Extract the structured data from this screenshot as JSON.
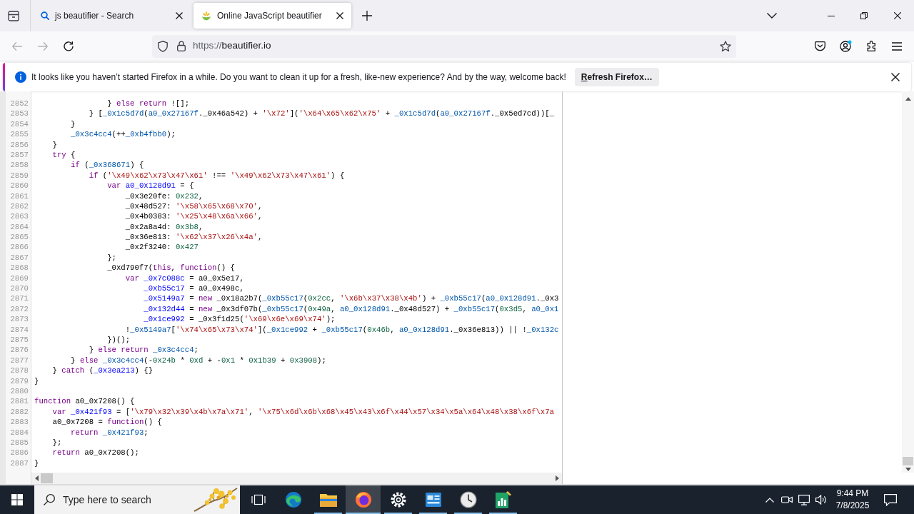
{
  "browser": {
    "tabs": [
      {
        "title": "js beautifier - Search",
        "selected": false
      },
      {
        "title": "Online JavaScript beautifier",
        "selected": true
      }
    ],
    "navigation": {
      "back": {
        "disabled": true
      },
      "forward": {
        "disabled": true
      }
    },
    "address": {
      "scheme": "https://",
      "host": "beautifier.io"
    }
  },
  "notification": {
    "message": "It looks like you haven’t started Firefox in a while. Do you want to clean it up for a fresh, like-new experience? And by the way, welcome back!",
    "button": "Refresh Firefox…"
  },
  "editor": {
    "lines": [
      {
        "number": "2852",
        "tokens": [
          {
            "kind": "plain",
            "text": "                } "
          },
          {
            "kind": "keyword",
            "text": "else"
          },
          {
            "kind": "keyword",
            "text": " return"
          },
          {
            "kind": "plain",
            "text": " ![];"
          }
        ]
      },
      {
        "number": "2853",
        "tokens": [
          {
            "kind": "plain",
            "text": "            } ["
          },
          {
            "kind": "variable",
            "text": "_0x1c5d7d"
          },
          {
            "kind": "plain",
            "text": "("
          },
          {
            "kind": "variable",
            "text": "a0_0x27167f"
          },
          {
            "kind": "plain",
            "text": "._0x46a542) + "
          },
          {
            "kind": "string",
            "text": "'\\x72'"
          },
          {
            "kind": "plain",
            "text": "]("
          },
          {
            "kind": "string",
            "text": "'\\x64\\x65\\x62\\x75'"
          },
          {
            "kind": "plain",
            "text": " + "
          },
          {
            "kind": "variable",
            "text": "_0x1c5d7d"
          },
          {
            "kind": "plain",
            "text": "("
          },
          {
            "kind": "variable",
            "text": "a0_0x27167f"
          },
          {
            "kind": "plain",
            "text": "._0x5ed7cd))[_"
          }
        ]
      },
      {
        "number": "2854",
        "tokens": [
          {
            "kind": "plain",
            "text": "        }"
          }
        ]
      },
      {
        "number": "2855",
        "tokens": [
          {
            "kind": "variable",
            "text": "        _0x3c4cc4"
          },
          {
            "kind": "plain",
            "text": "(++"
          },
          {
            "kind": "variable",
            "text": "_0xb4fbb0"
          },
          {
            "kind": "plain",
            "text": ");"
          }
        ]
      },
      {
        "number": "2856",
        "tokens": [
          {
            "kind": "plain",
            "text": "    }"
          }
        ]
      },
      {
        "number": "2857",
        "tokens": [
          {
            "kind": "keyword",
            "text": "    try"
          },
          {
            "kind": "plain",
            "text": " {"
          }
        ]
      },
      {
        "number": "2858",
        "tokens": [
          {
            "kind": "keyword",
            "text": "        if"
          },
          {
            "kind": "plain",
            "text": " ("
          },
          {
            "kind": "variable",
            "text": "_0x368671"
          },
          {
            "kind": "plain",
            "text": ") {"
          }
        ]
      },
      {
        "number": "2859",
        "tokens": [
          {
            "kind": "keyword",
            "text": "            if"
          },
          {
            "kind": "plain",
            "text": " ("
          },
          {
            "kind": "string",
            "text": "'\\x49\\x62\\x73\\x47\\x61'"
          },
          {
            "kind": "plain",
            "text": " !== "
          },
          {
            "kind": "string",
            "text": "'\\x49\\x62\\x73\\x47\\x61'"
          },
          {
            "kind": "plain",
            "text": ") {"
          }
        ]
      },
      {
        "number": "2860",
        "tokens": [
          {
            "kind": "keyword",
            "text": "                var "
          },
          {
            "kind": "def",
            "text": "a0_0x128d91"
          },
          {
            "kind": "plain",
            "text": " = {"
          }
        ]
      },
      {
        "number": "2861",
        "tokens": [
          {
            "kind": "plain",
            "text": "                    _0x3e20fe: "
          },
          {
            "kind": "number",
            "text": "0x232"
          },
          {
            "kind": "plain",
            "text": ","
          }
        ]
      },
      {
        "number": "2862",
        "tokens": [
          {
            "kind": "plain",
            "text": "                    _0x48d527: "
          },
          {
            "kind": "string",
            "text": "'\\x58\\x65\\x68\\x70'"
          },
          {
            "kind": "plain",
            "text": ","
          }
        ]
      },
      {
        "number": "2863",
        "tokens": [
          {
            "kind": "plain",
            "text": "                    _0x4b0383: "
          },
          {
            "kind": "string",
            "text": "'\\x25\\x48\\x6a\\x66'"
          },
          {
            "kind": "plain",
            "text": ","
          }
        ]
      },
      {
        "number": "2864",
        "tokens": [
          {
            "kind": "plain",
            "text": "                    _0x2a8a4d: "
          },
          {
            "kind": "number",
            "text": "0x3b8"
          },
          {
            "kind": "plain",
            "text": ","
          }
        ]
      },
      {
        "number": "2865",
        "tokens": [
          {
            "kind": "plain",
            "text": "                    _0x36e813: "
          },
          {
            "kind": "string",
            "text": "'\\x62\\x37\\x26\\x4a'"
          },
          {
            "kind": "plain",
            "text": ","
          }
        ]
      },
      {
        "number": "2866",
        "tokens": [
          {
            "kind": "plain",
            "text": "                    _0x2f3240: "
          },
          {
            "kind": "number",
            "text": "0x427"
          }
        ]
      },
      {
        "number": "2867",
        "tokens": [
          {
            "kind": "plain",
            "text": "                };"
          }
        ]
      },
      {
        "number": "2868",
        "tokens": [
          {
            "kind": "plain",
            "text": "                _0xd790f7("
          },
          {
            "kind": "keyword",
            "text": "this"
          },
          {
            "kind": "plain",
            "text": ", "
          },
          {
            "kind": "keyword",
            "text": "function"
          },
          {
            "kind": "plain",
            "text": "() {"
          }
        ]
      },
      {
        "number": "2869",
        "tokens": [
          {
            "kind": "keyword",
            "text": "                    var "
          },
          {
            "kind": "def",
            "text": "_0x7c088c"
          },
          {
            "kind": "plain",
            "text": " = a0_0x5e17,"
          }
        ]
      },
      {
        "number": "2870",
        "tokens": [
          {
            "kind": "def",
            "text": "                        _0xb55c17"
          },
          {
            "kind": "plain",
            "text": " = a0_0x498c,"
          }
        ]
      },
      {
        "number": "2871",
        "tokens": [
          {
            "kind": "def",
            "text": "                        _0x5149a7"
          },
          {
            "kind": "plain",
            "text": " = "
          },
          {
            "kind": "keyword",
            "text": "new"
          },
          {
            "kind": "plain",
            "text": " _0x18a2b7("
          },
          {
            "kind": "variable",
            "text": "_0xb55c17"
          },
          {
            "kind": "plain",
            "text": "("
          },
          {
            "kind": "number",
            "text": "0x2cc"
          },
          {
            "kind": "plain",
            "text": ", "
          },
          {
            "kind": "string",
            "text": "'\\x6b\\x37\\x38\\x4b'"
          },
          {
            "kind": "plain",
            "text": ") + "
          },
          {
            "kind": "variable",
            "text": "_0xb55c17"
          },
          {
            "kind": "plain",
            "text": "("
          },
          {
            "kind": "variable",
            "text": "a0_0x128d91"
          },
          {
            "kind": "plain",
            "text": "._0x3"
          }
        ]
      },
      {
        "number": "2872",
        "tokens": [
          {
            "kind": "def",
            "text": "                        _0x132d44"
          },
          {
            "kind": "plain",
            "text": " = "
          },
          {
            "kind": "keyword",
            "text": "new"
          },
          {
            "kind": "plain",
            "text": " _0x3df07b("
          },
          {
            "kind": "variable",
            "text": "_0xb55c17"
          },
          {
            "kind": "plain",
            "text": "("
          },
          {
            "kind": "number",
            "text": "0x49a"
          },
          {
            "kind": "plain",
            "text": ", "
          },
          {
            "kind": "variable",
            "text": "a0_0x128d91"
          },
          {
            "kind": "plain",
            "text": "._0x48d527) + "
          },
          {
            "kind": "variable",
            "text": "_0xb55c17"
          },
          {
            "kind": "plain",
            "text": "("
          },
          {
            "kind": "number",
            "text": "0x3d5"
          },
          {
            "kind": "plain",
            "text": ", "
          },
          {
            "kind": "variable",
            "text": "a0_0x1"
          }
        ]
      },
      {
        "number": "2873",
        "tokens": [
          {
            "kind": "def",
            "text": "                        _0x1ce992"
          },
          {
            "kind": "plain",
            "text": " = _0x3f1d25("
          },
          {
            "kind": "string",
            "text": "'\\x69\\x6e\\x69\\x74'"
          },
          {
            "kind": "plain",
            "text": ");"
          }
        ]
      },
      {
        "number": "2874",
        "tokens": [
          {
            "kind": "plain",
            "text": "                    !"
          },
          {
            "kind": "variable",
            "text": "_0x5149a7"
          },
          {
            "kind": "plain",
            "text": "["
          },
          {
            "kind": "string",
            "text": "'\\x74\\x65\\x73\\x74'"
          },
          {
            "kind": "plain",
            "text": "]("
          },
          {
            "kind": "variable",
            "text": "_0x1ce992"
          },
          {
            "kind": "plain",
            "text": " + "
          },
          {
            "kind": "variable",
            "text": "_0xb55c17"
          },
          {
            "kind": "plain",
            "text": "("
          },
          {
            "kind": "number",
            "text": "0x46b"
          },
          {
            "kind": "plain",
            "text": ", "
          },
          {
            "kind": "variable",
            "text": "a0_0x128d91"
          },
          {
            "kind": "plain",
            "text": "._0x36e813)) || !"
          },
          {
            "kind": "variable",
            "text": "_0x132c"
          }
        ]
      },
      {
        "number": "2875",
        "tokens": [
          {
            "kind": "plain",
            "text": "                })();"
          }
        ]
      },
      {
        "number": "2876",
        "tokens": [
          {
            "kind": "plain",
            "text": "            } "
          },
          {
            "kind": "keyword",
            "text": "else"
          },
          {
            "kind": "keyword",
            "text": " return "
          },
          {
            "kind": "variable",
            "text": "_0x3c4cc4"
          },
          {
            "kind": "plain",
            "text": ";"
          }
        ]
      },
      {
        "number": "2877",
        "tokens": [
          {
            "kind": "plain",
            "text": "        } "
          },
          {
            "kind": "keyword",
            "text": "else "
          },
          {
            "kind": "variable",
            "text": "_0x3c4cc4"
          },
          {
            "kind": "plain",
            "text": "(-"
          },
          {
            "kind": "number",
            "text": "0x24b"
          },
          {
            "kind": "plain",
            "text": " * "
          },
          {
            "kind": "number",
            "text": "0xd"
          },
          {
            "kind": "plain",
            "text": " + -"
          },
          {
            "kind": "number",
            "text": "0x1"
          },
          {
            "kind": "plain",
            "text": " * "
          },
          {
            "kind": "number",
            "text": "0x1b39"
          },
          {
            "kind": "plain",
            "text": " + "
          },
          {
            "kind": "number",
            "text": "0x3908"
          },
          {
            "kind": "plain",
            "text": ");"
          }
        ]
      },
      {
        "number": "2878",
        "tokens": [
          {
            "kind": "plain",
            "text": "    } "
          },
          {
            "kind": "keyword",
            "text": "catch"
          },
          {
            "kind": "plain",
            "text": " ("
          },
          {
            "kind": "def",
            "text": "_0x3ea213"
          },
          {
            "kind": "plain",
            "text": ") {}"
          }
        ]
      },
      {
        "number": "2879",
        "tokens": [
          {
            "kind": "plain",
            "text": "}"
          }
        ]
      },
      {
        "number": "2880"
      },
      {
        "number": "2881",
        "tokens": [
          {
            "kind": "keyword",
            "text": "function"
          },
          {
            "kind": "plain",
            "text": " a0_0x7208() {"
          }
        ]
      },
      {
        "number": "2882",
        "tokens": [
          {
            "kind": "keyword",
            "text": "    var "
          },
          {
            "kind": "def",
            "text": "_0x421f93"
          },
          {
            "kind": "plain",
            "text": " = ["
          },
          {
            "kind": "string",
            "text": "'\\x79\\x32\\x39\\x4b\\x7a\\x71'"
          },
          {
            "kind": "plain",
            "text": ", "
          },
          {
            "kind": "string",
            "text": "'\\x75\\x6d\\x6b\\x68\\x45\\x43\\x6f\\x44\\x57\\x34\\x5a\\x64\\x48\\x38\\x6f\\x7a"
          }
        ]
      },
      {
        "number": "2883",
        "tokens": [
          {
            "kind": "plain",
            "text": "    a0_0x7208 = "
          },
          {
            "kind": "keyword",
            "text": "function"
          },
          {
            "kind": "plain",
            "text": "() {"
          }
        ]
      },
      {
        "number": "2884",
        "tokens": [
          {
            "kind": "keyword",
            "text": "        return "
          },
          {
            "kind": "variable",
            "text": "_0x421f93"
          },
          {
            "kind": "plain",
            "text": ";"
          }
        ]
      },
      {
        "number": "2885",
        "tokens": [
          {
            "kind": "plain",
            "text": "    };"
          }
        ]
      },
      {
        "number": "2886",
        "tokens": [
          {
            "kind": "keyword",
            "text": "    return"
          },
          {
            "kind": "plain",
            "text": " a0_0x7208();"
          }
        ]
      },
      {
        "number": "2887",
        "tokens": [
          {
            "kind": "plain",
            "text": "}"
          }
        ]
      }
    ]
  },
  "taskbar": {
    "search": {
      "placeholder": "Type here to search"
    },
    "apps": [
      {
        "selected": false,
        "running": false
      },
      {
        "selected": false,
        "running": true
      },
      {
        "selected": true,
        "running": true
      },
      {
        "selected": false,
        "running": true
      },
      {
        "selected": false,
        "running": true
      },
      {
        "selected": false,
        "running": true
      },
      {
        "selected": false,
        "running": true
      }
    ],
    "clock": {
      "time": "9:44 PM",
      "date": "7/8/2025"
    }
  }
}
